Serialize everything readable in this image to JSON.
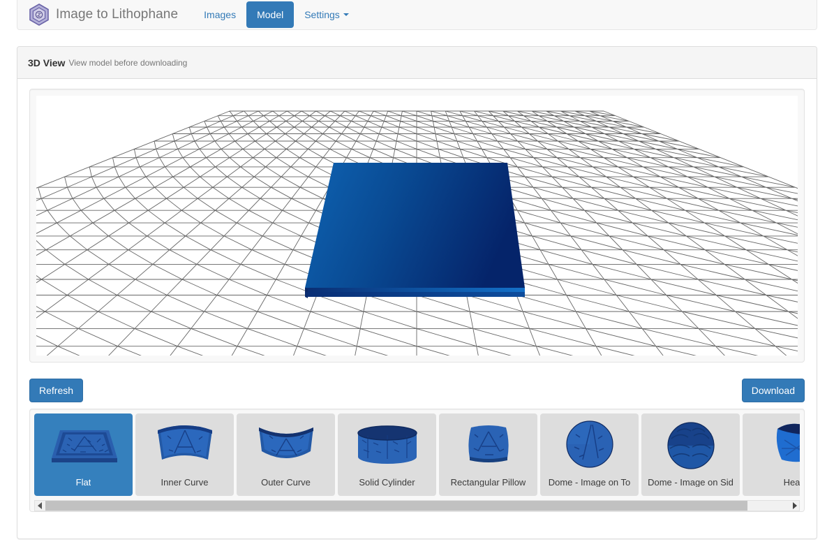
{
  "navbar": {
    "logo_icon": "hexagon-logo-icon",
    "brand": "Image to Lithophane",
    "items": [
      {
        "label": "Images",
        "active": false,
        "caret": false
      },
      {
        "label": "Model",
        "active": true,
        "caret": false
      },
      {
        "label": "Settings",
        "active": false,
        "caret": true
      }
    ],
    "colors": {
      "active_bg": "#337ab7",
      "link": "#337ab7",
      "brand_text": "#777777",
      "bar_bg": "#f8f8f8"
    }
  },
  "panel": {
    "title": "3D View",
    "subtitle": "View model before downloading",
    "heading_bg": "#f5f5f5",
    "border": "#dddddd"
  },
  "viewer": {
    "name": "3d-model-viewport",
    "background": "#ffffff",
    "grid_color": "#666666",
    "model": {
      "shape": "flat-slab",
      "top_color_left": "#0a5fae",
      "top_color_right": "#062a6b",
      "side_color": "#0b2f70",
      "front_edge_color": "#0d3f8e"
    }
  },
  "actions": {
    "refresh_label": "Refresh",
    "download_label": "Download",
    "button_bg": "#337ab7",
    "button_border": "#2e6da4"
  },
  "carousel": {
    "selected_index": 0,
    "selected_bg": "#3580bd",
    "item_bg": "#dddddd",
    "items": [
      {
        "label": "Flat",
        "icon": "flat-lithophane-thumb",
        "selected": true
      },
      {
        "label": "Inner Curve",
        "icon": "inner-curve-lithophane-thumb",
        "selected": false
      },
      {
        "label": "Outer Curve",
        "icon": "outer-curve-lithophane-thumb",
        "selected": false
      },
      {
        "label": "Solid Cylinder",
        "icon": "solid-cylinder-lithophane-thumb",
        "selected": false
      },
      {
        "label": "Rectangular Pillow",
        "icon": "rectangular-pillow-lithophane-thumb",
        "selected": false
      },
      {
        "label": "Dome - Image on To",
        "icon": "dome-image-on-top-lithophane-thumb",
        "selected": false
      },
      {
        "label": "Dome - Image on Sid",
        "icon": "dome-image-on-side-lithophane-thumb",
        "selected": false
      },
      {
        "label": "Hea",
        "icon": "heart-lithophane-thumb",
        "selected": false
      }
    ],
    "scrollbar": {
      "left_arrow_icon": "triangle-left-icon",
      "right_arrow_icon": "triangle-right-icon",
      "thumb_color": "#c1c1c1",
      "track_color": "#f1f1f1"
    }
  }
}
